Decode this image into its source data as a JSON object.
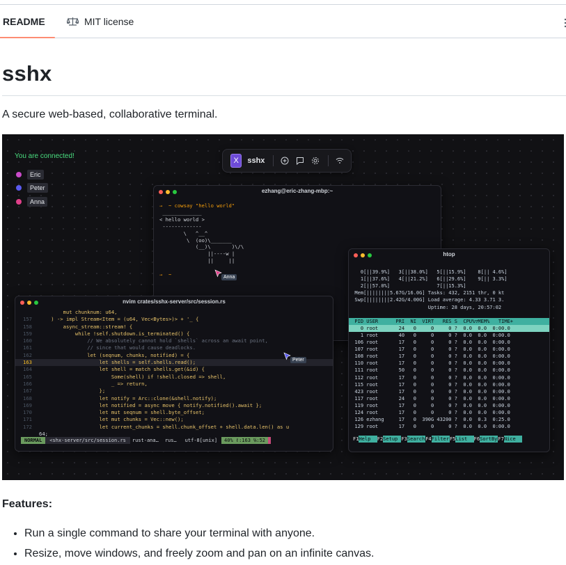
{
  "tabs": [
    {
      "label": "README",
      "icon": "book-icon"
    },
    {
      "label": "MIT license",
      "icon": "scale-icon"
    }
  ],
  "title": "sshx",
  "tagline": "A secure web-based, collaborative terminal.",
  "screenshot": {
    "connected": "You are connected!",
    "users": [
      {
        "name": "Eric",
        "color": "#c94bc9"
      },
      {
        "name": "Peter",
        "color": "#5b5bf0"
      },
      {
        "name": "Anna",
        "color": "#e0408a"
      }
    ],
    "toolbar": {
      "logo": "X",
      "title": "sshx"
    },
    "win1": {
      "title": "ezhang@eric-zhang-mbp:~",
      "lines": [
        "→  ~ cowsay \"hello world\"",
        " _____________",
        "< hello world >",
        " -------------",
        "        \\   ^__^",
        "         \\  (oo)\\_______",
        "            (__)\\       )\\/\\",
        "                ||----w |",
        "                ||     ||",
        "",
        "→  ~"
      ],
      "cursor": "Anna"
    },
    "win2": {
      "title": "nvim crates/sshx-server/src/session.rs",
      "lines": [
        {
          "n": "",
          "t": "        mut chunknum: u64,"
        },
        {
          "n": "157",
          "t": "    ) -> impl Stream<Item = (u64, Vec<Bytes>)> + '_ {"
        },
        {
          "n": "158",
          "t": "        async_stream::stream! {"
        },
        {
          "n": "159",
          "t": "            while !self.shutdown.is_terminated() {"
        },
        {
          "n": "160",
          "t": "                // We absolutely cannot hold `shells` across an await point,"
        },
        {
          "n": "161",
          "t": "                // since that would cause deadlocks."
        },
        {
          "n": "162",
          "t": "                let (seqnum, chunks, notified) = {"
        },
        {
          "n": "163",
          "t": "                    let shells = self.shells.read();"
        },
        {
          "n": "164",
          "t": "                    let shell = match shells.get(&id) {"
        },
        {
          "n": "165",
          "t": "                        Some(shell) if !shell.closed => shell,"
        },
        {
          "n": "166",
          "t": "                        _ => return,"
        },
        {
          "n": "167",
          "t": "                    };"
        },
        {
          "n": "168",
          "t": "                    let notify = Arc::clone(&shell.notify);"
        },
        {
          "n": "169",
          "t": "                    let notified = async move { notify.notified().await };"
        },
        {
          "n": "170",
          "t": "                    let mut seqnum = shell.byte_offset;"
        },
        {
          "n": "171",
          "t": "                    let mut chunks = Vec::new();"
        },
        {
          "n": "172",
          "t": "                    let current_chunks = shell.chunk_offset + shell.data.len() as u"
        },
        {
          "n": "",
          "t": "64;"
        }
      ],
      "highlight_line": 7,
      "status": {
        "mode": "NORMAL",
        "file": "<shx-server/src/session.rs",
        "lsp": "rust-ana…",
        "lsp2": "rus…",
        "enc": "utf-8[unix]",
        "pos": "40% ℓ:163 ℅:52"
      },
      "cursor": "Peter"
    },
    "win3": {
      "title": "htop",
      "meters": [
        "    0[||39.9%]   3[||38.0%]   5[||15.9%]    8[|| 4.6%]",
        "    1[||37.6%]   4[||21.2%]   6[||29.6%]    9[|| 3.3%]",
        "    2[||57.0%]                7[||15.3%]",
        "  Mem[||||||||5.67G/16.0G] Tasks: 432, 2151 thr, 0 kt",
        "  Swp[||||||||2.42G/4.00G] Load average: 4.33 3.71 3.",
        "                           Uptime: 28 days, 20:57:02"
      ],
      "header": "  PID USER      PRI  NI  VIRT   RES S  CPU%▽MEM%   TIME+",
      "procs": [
        "    0 root       24   0     0     0 ?  0.0  0.0  0:00.0",
        "    1 root       40   0     0     0 ?  0.0  0.0  0:00.0",
        "  106 root       17   0     0     0 ?  0.0  0.0  0:00.0",
        "  107 root       17   0     0     0 ?  0.0  0.0  0:00.0",
        "  108 root       17   0     0     0 ?  0.0  0.0  0:00.0",
        "  110 root       17   0     0     0 ?  0.0  0.0  0:00.0",
        "  111 root       50   0     0     0 ?  0.0  0.0  0:00.0",
        "  112 root       17   0     0     0 ?  0.0  0.0  0:00.0",
        "  115 root       17   0     0     0 ?  0.0  0.0  0:00.0",
        "  423 root       17   0     0     0 ?  0.0  0.0  0:00.0",
        "  117 root       24   0     0     0 ?  0.0  0.0  0:00.0",
        "  119 root       17   0     0     0 ?  0.0  0.0  0:00.0",
        "  124 root       17   0     0     0 ?  0.0  0.0  0:00.0",
        "  126 ezhang     17   0  390G 43200 ?  0.0  0.3  0:25.0",
        "  129 root       17   0     0     0 ?  0.0  0.0  0:00.0"
      ],
      "fkeys": [
        {
          "k": "F1",
          "l": "Help  "
        },
        {
          "k": "F2",
          "l": "Setup "
        },
        {
          "k": "F3",
          "l": "Search"
        },
        {
          "k": "F4",
          "l": "Filter"
        },
        {
          "k": "F5",
          "l": "List  "
        },
        {
          "k": "F6",
          "l": "SortBy"
        },
        {
          "k": "F7",
          "l": "Nice  "
        }
      ]
    }
  },
  "features_heading": "Features:",
  "features": [
    "Run a single command to share your terminal with anyone.",
    "Resize, move windows, and freely zoom and pan on an infinite canvas."
  ]
}
